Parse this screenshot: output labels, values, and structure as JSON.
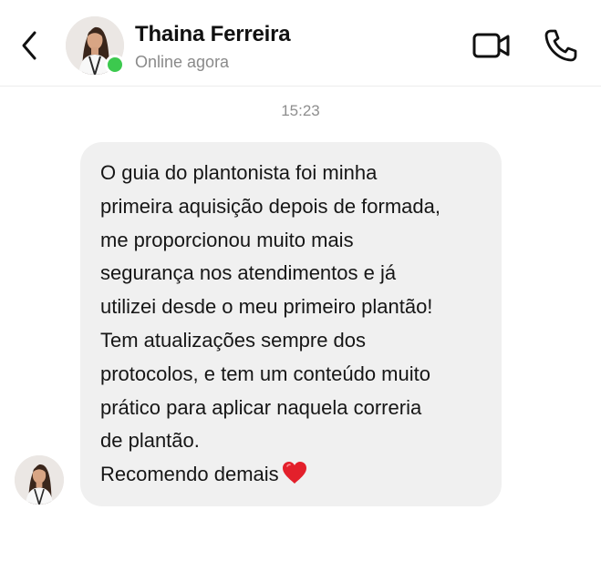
{
  "header": {
    "back_icon": "chevron-left-icon",
    "contact_name": "Thaina Ferreira",
    "status": "Online agora",
    "online_color": "#3cc94e",
    "video_icon": "video-camera-icon",
    "call_icon": "phone-icon"
  },
  "conversation": {
    "timestamp": "15:23",
    "message": {
      "lines": [
        "O guia do plantonista foi minha",
        "primeira aquisição depois de formada,",
        "me proporcionou muito mais",
        "segurança nos atendimentos e já",
        "utilizei desde o meu primeiro plantão!",
        "Tem atualizações sempre dos",
        "protocolos, e tem um conteúdo muito",
        "prático para aplicar naquela correria",
        "de plantão.",
        "Recomendo demais"
      ],
      "emoji": "heart-icon",
      "bubble_color": "#f0f0f0"
    }
  }
}
